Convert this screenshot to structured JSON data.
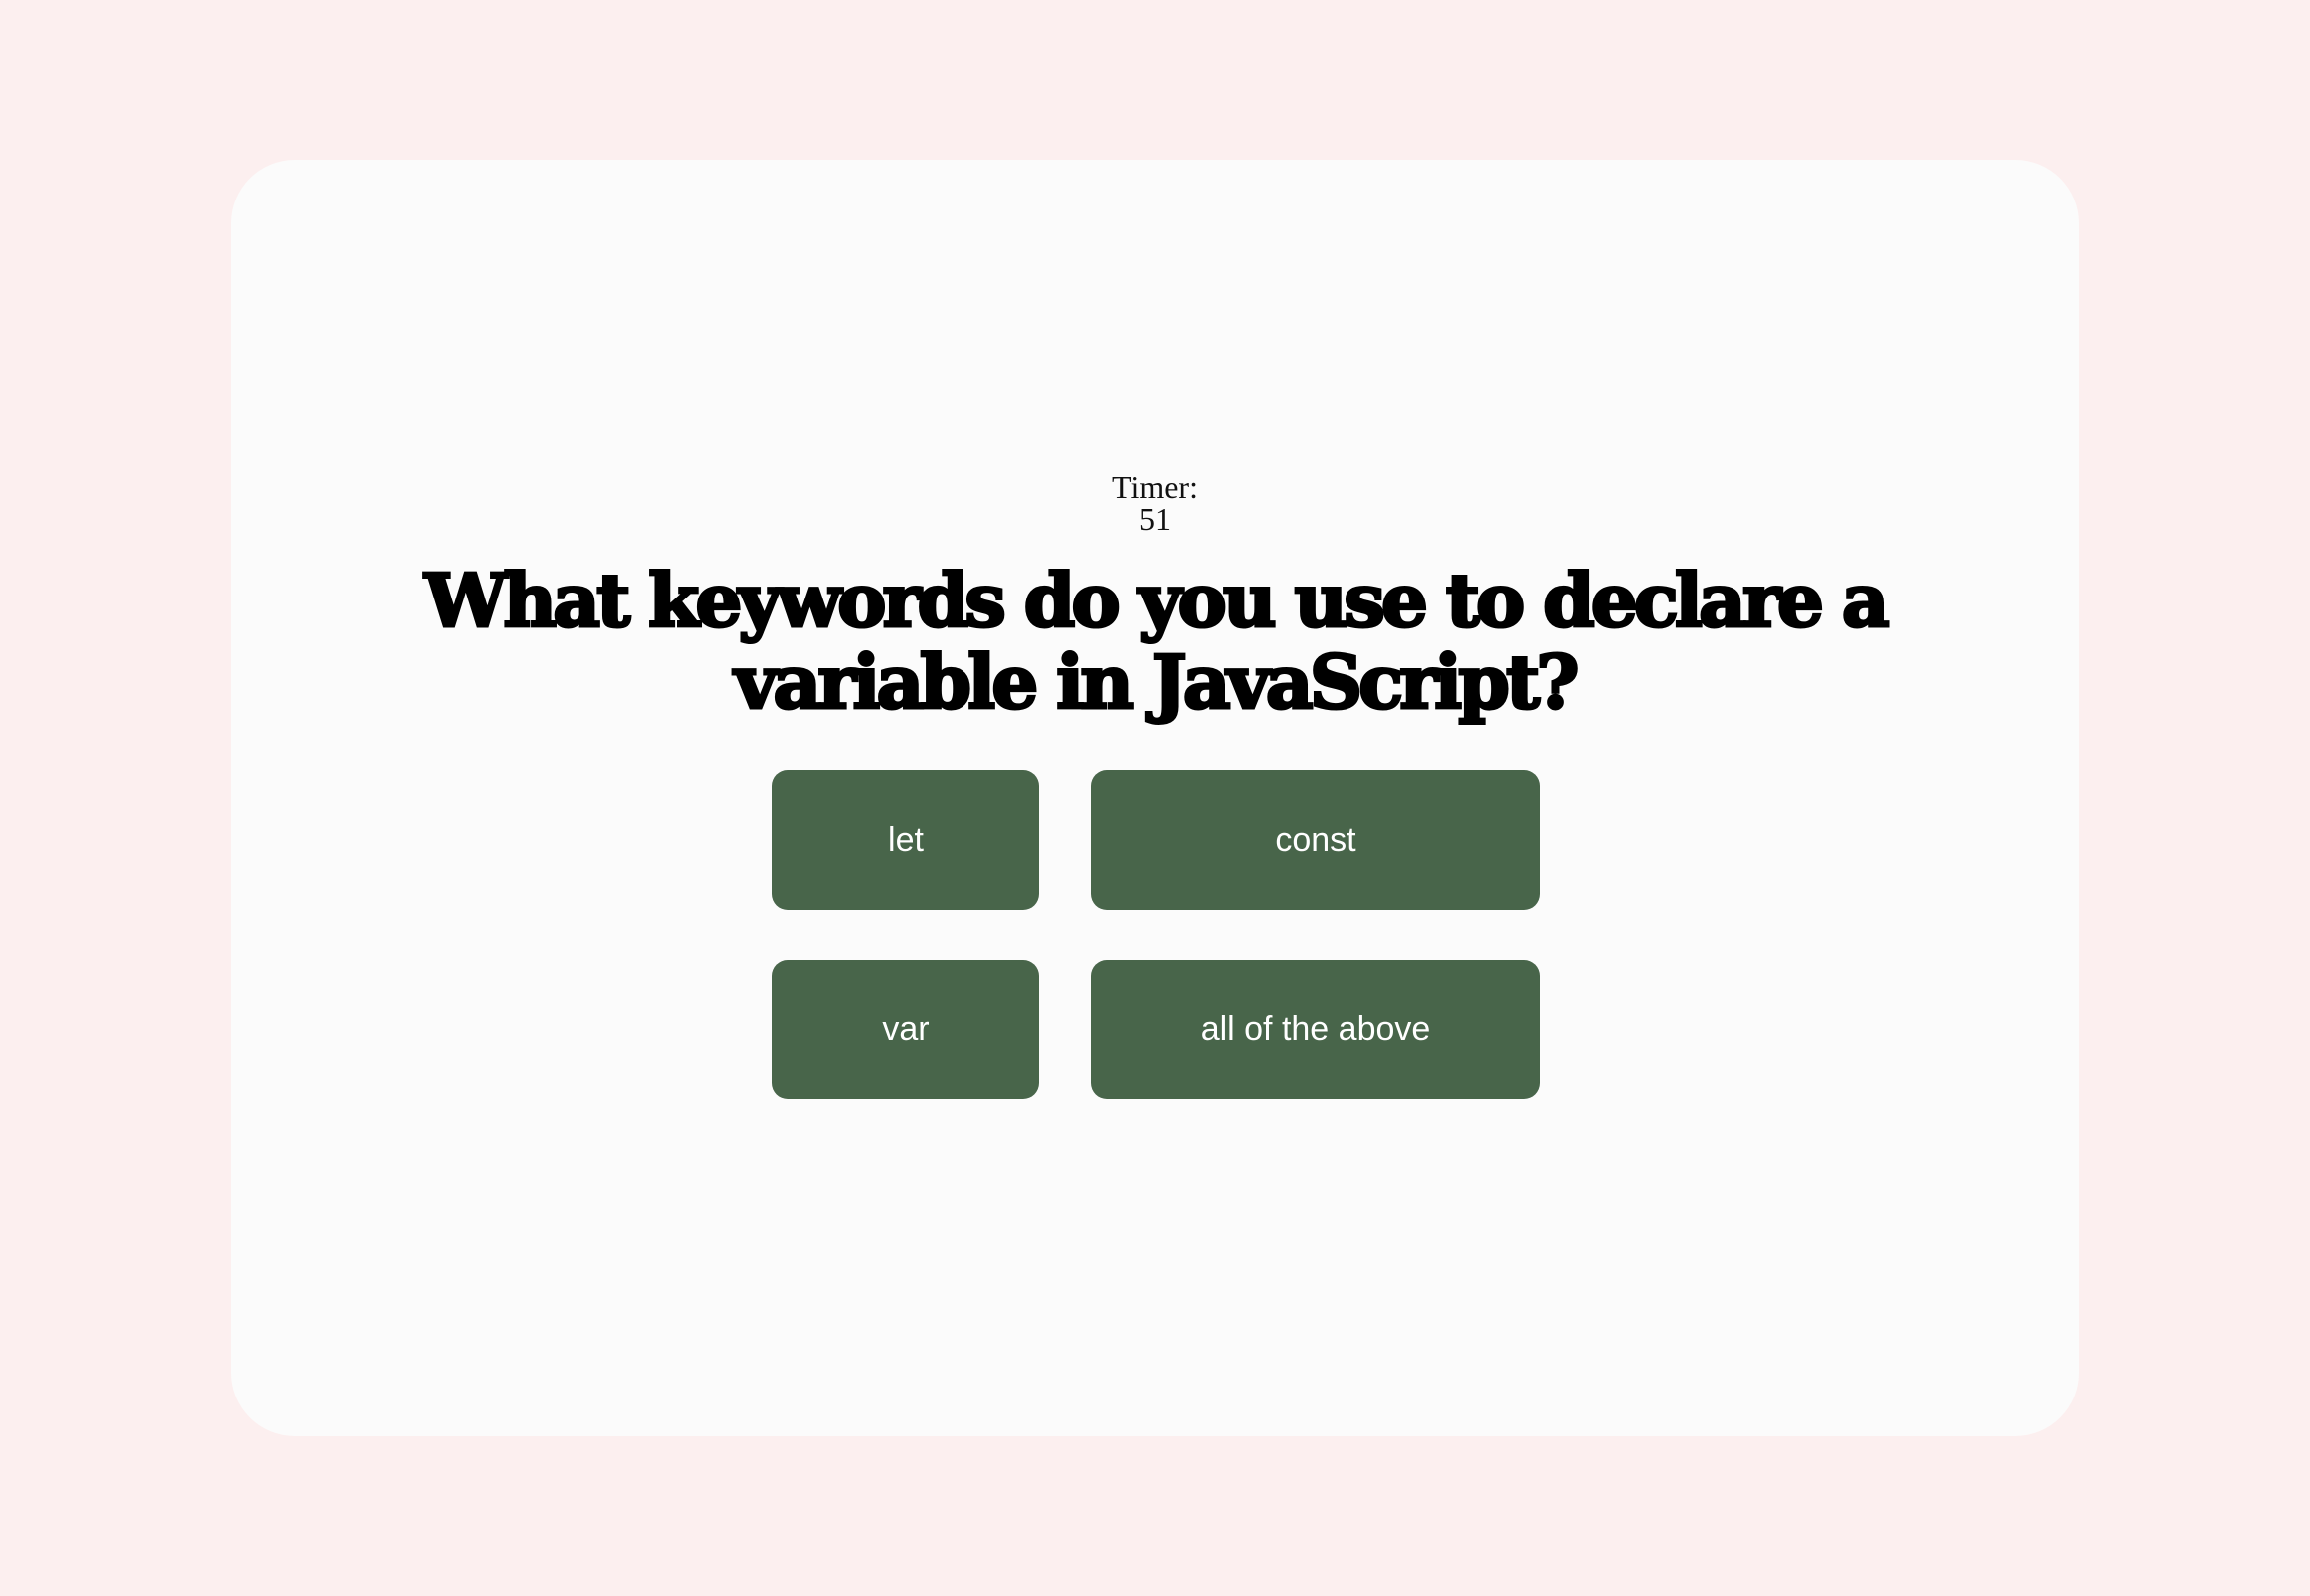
{
  "timer": {
    "label": "Timer:",
    "value": "51"
  },
  "question": {
    "text": "What keywords do you use to declare a variable in JavaScript?"
  },
  "answers": [
    {
      "label": "let"
    },
    {
      "label": "const"
    },
    {
      "label": "var"
    },
    {
      "label": "all of the above"
    }
  ],
  "colors": {
    "page_background": "#fcefef",
    "card_background": "#fbfbfb",
    "button_background": "#48654a",
    "button_text": "#ffffff"
  }
}
